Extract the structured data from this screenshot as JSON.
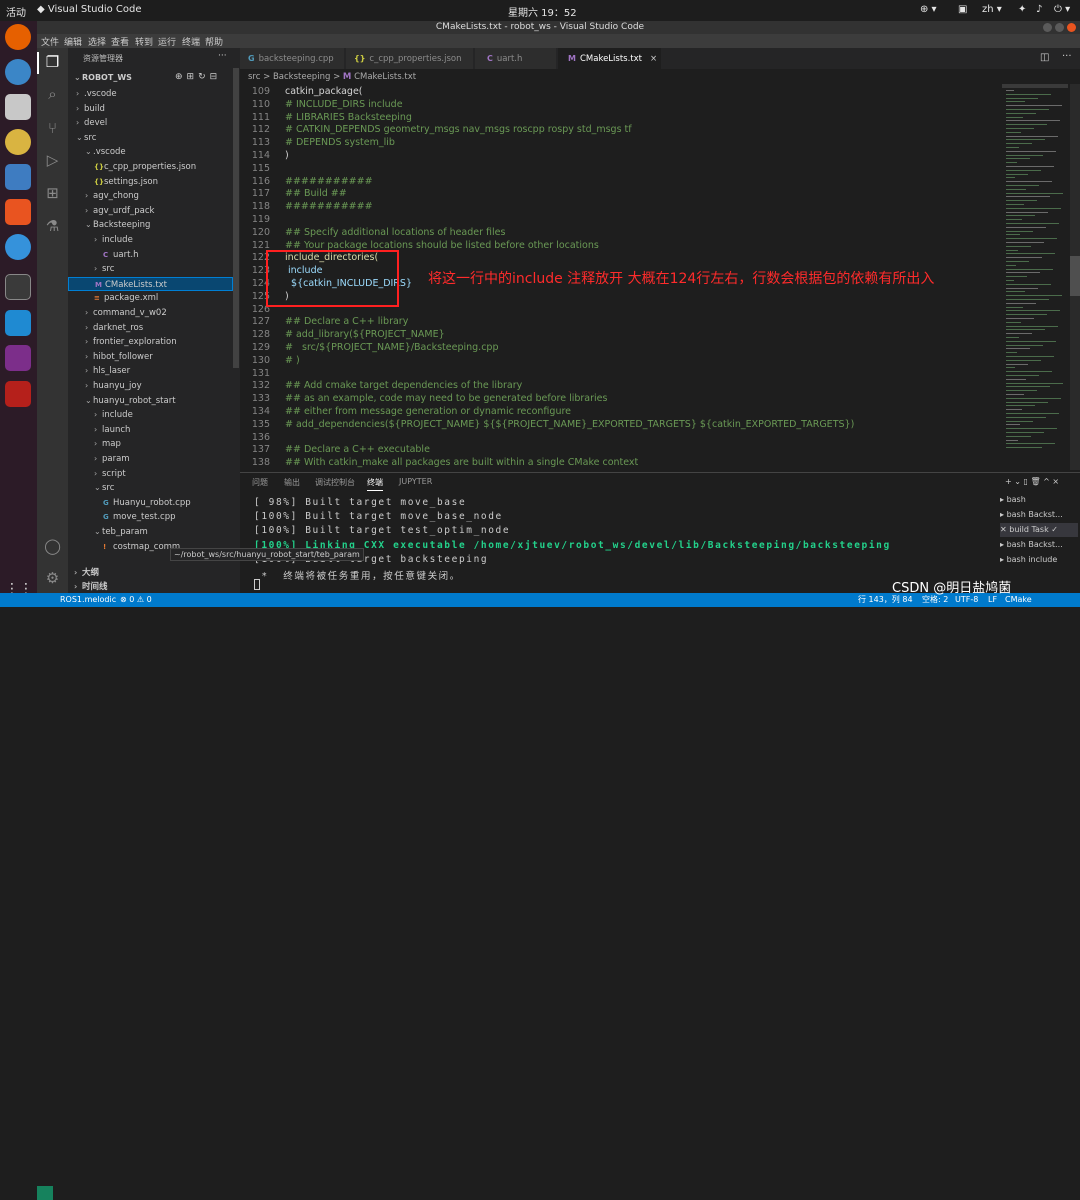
{
  "system_bar": {
    "activities": "活动",
    "app": "Visual Studio Code",
    "clock": "星期六 19：52",
    "lang": "zh"
  },
  "window": {
    "title": "CMakeLists.txt - robot_ws - Visual Studio Code"
  },
  "menu": [
    "文件",
    "编辑",
    "选择",
    "查看",
    "转到",
    "运行",
    "终端",
    "帮助"
  ],
  "sidebar": {
    "header": "资源管理器",
    "more": "···",
    "root": "ROBOT_WS",
    "tooltip": "~/robot_ws/src/huanyu_robot_start/teb_param",
    "outline": "大纲",
    "timeline": "时间线",
    "items": [
      {
        "label": ".vscode",
        "type": "folder",
        "open": false,
        "depth": 0
      },
      {
        "label": "build",
        "type": "folder",
        "open": false,
        "depth": 0
      },
      {
        "label": "devel",
        "type": "folder",
        "open": false,
        "depth": 0
      },
      {
        "label": "src",
        "type": "folder",
        "open": true,
        "depth": 0
      },
      {
        "label": ".vscode",
        "type": "folder",
        "open": true,
        "depth": 1
      },
      {
        "label": "c_cpp_properties.json",
        "type": "json",
        "icon": "{}",
        "depth": 2
      },
      {
        "label": "settings.json",
        "type": "json",
        "icon": "{}",
        "depth": 2
      },
      {
        "label": "agv_chong",
        "type": "folder",
        "open": false,
        "depth": 1
      },
      {
        "label": "agv_urdf_pack",
        "type": "folder",
        "open": false,
        "depth": 1
      },
      {
        "label": "Backsteeping",
        "type": "folder",
        "open": true,
        "depth": 1
      },
      {
        "label": "include",
        "type": "folder",
        "open": false,
        "depth": 2
      },
      {
        "label": "uart.h",
        "type": "c",
        "icon": "C",
        "depth": 3
      },
      {
        "label": "src",
        "type": "folder",
        "open": false,
        "depth": 2
      },
      {
        "label": "CMakeLists.txt",
        "type": "cmake",
        "icon": "M",
        "depth": 2,
        "selected": true
      },
      {
        "label": "package.xml",
        "type": "xml",
        "icon": "≡",
        "depth": 2
      },
      {
        "label": "command_v_w02",
        "type": "folder",
        "open": false,
        "depth": 1
      },
      {
        "label": "darknet_ros",
        "type": "folder",
        "open": false,
        "depth": 1
      },
      {
        "label": "frontier_exploration",
        "type": "folder",
        "open": false,
        "depth": 1
      },
      {
        "label": "hibot_follower",
        "type": "folder",
        "open": false,
        "depth": 1
      },
      {
        "label": "hls_laser",
        "type": "folder",
        "open": false,
        "depth": 1
      },
      {
        "label": "huanyu_joy",
        "type": "folder",
        "open": false,
        "depth": 1
      },
      {
        "label": "huanyu_robot_start",
        "type": "folder",
        "open": true,
        "depth": 1
      },
      {
        "label": "include",
        "type": "folder",
        "open": false,
        "depth": 2
      },
      {
        "label": "launch",
        "type": "folder",
        "open": false,
        "depth": 2
      },
      {
        "label": "map",
        "type": "folder",
        "open": false,
        "depth": 2
      },
      {
        "label": "param",
        "type": "folder",
        "open": false,
        "depth": 2
      },
      {
        "label": "script",
        "type": "folder",
        "open": false,
        "depth": 2
      },
      {
        "label": "src",
        "type": "folder",
        "open": true,
        "depth": 2
      },
      {
        "label": "Huanyu_robot.cpp",
        "type": "cpp",
        "icon": "G",
        "depth": 3
      },
      {
        "label": "move_test.cpp",
        "type": "cpp",
        "icon": "G",
        "depth": 3
      },
      {
        "label": "teb_param",
        "type": "folder",
        "open": true,
        "depth": 2
      },
      {
        "label": "costmap_comm",
        "type": "xml",
        "icon": "!",
        "depth": 3
      }
    ]
  },
  "tabs": [
    {
      "label": "backsteeping.cpp",
      "icon": "G",
      "color": "#519aba"
    },
    {
      "label": "c_cpp_properties.json",
      "icon": "{}",
      "color": "#cbcb41"
    },
    {
      "label": "uart.h",
      "icon": "C",
      "color": "#a074c4"
    },
    {
      "label": "CMakeLists.txt",
      "icon": "M",
      "color": "#a074c4",
      "active": true,
      "close": "×"
    }
  ],
  "breadcrumb": {
    "folder1": "src",
    "sep": ">",
    "folder2": "Backsteeping",
    "file": "CMakeLists.txt"
  },
  "code_lines": [
    {
      "n": "109",
      "t": "catkin_package(",
      "c": "def"
    },
    {
      "n": "110",
      "t": "# INCLUDE_DIRS include",
      "c": "com"
    },
    {
      "n": "111",
      "t": "# LIBRARIES Backsteeping",
      "c": "com"
    },
    {
      "n": "112",
      "t": "# CATKIN_DEPENDS geometry_msgs nav_msgs roscpp rospy std_msgs tf",
      "c": "com"
    },
    {
      "n": "113",
      "t": "# DEPENDS system_lib",
      "c": "com"
    },
    {
      "n": "114",
      "t": ")",
      "c": "def"
    },
    {
      "n": "115",
      "t": "",
      "c": "def"
    },
    {
      "n": "116",
      "t": "###########",
      "c": "com"
    },
    {
      "n": "117",
      "t": "## Build ##",
      "c": "com"
    },
    {
      "n": "118",
      "t": "###########",
      "c": "com"
    },
    {
      "n": "119",
      "t": "",
      "c": "def"
    },
    {
      "n": "120",
      "t": "## Specify additional locations of header files",
      "c": "com"
    },
    {
      "n": "121",
      "t": "## Your package locations should be listed before other locations",
      "c": "com"
    },
    {
      "n": "122",
      "t": "include_directories(",
      "c": "fn"
    },
    {
      "n": "123",
      "t": " include",
      "c": "var"
    },
    {
      "n": "124",
      "t": "  ${catkin_INCLUDE_DIRS}",
      "c": "var"
    },
    {
      "n": "125",
      "t": ")",
      "c": "def"
    },
    {
      "n": "126",
      "t": "",
      "c": "def"
    },
    {
      "n": "127",
      "t": "## Declare a C++ library",
      "c": "com"
    },
    {
      "n": "128",
      "t": "# add_library(${PROJECT_NAME}",
      "c": "com"
    },
    {
      "n": "129",
      "t": "#   src/${PROJECT_NAME}/Backsteeping.cpp",
      "c": "com"
    },
    {
      "n": "130",
      "t": "# )",
      "c": "com"
    },
    {
      "n": "131",
      "t": "",
      "c": "def"
    },
    {
      "n": "132",
      "t": "## Add cmake target dependencies of the library",
      "c": "com"
    },
    {
      "n": "133",
      "t": "## as an example, code may need to be generated before libraries",
      "c": "com"
    },
    {
      "n": "134",
      "t": "## either from message generation or dynamic reconfigure",
      "c": "com"
    },
    {
      "n": "135",
      "t": "# add_dependencies(${PROJECT_NAME} ${${PROJECT_NAME}_EXPORTED_TARGETS} ${catkin_EXPORTED_TARGETS})",
      "c": "com"
    },
    {
      "n": "136",
      "t": "",
      "c": "def"
    },
    {
      "n": "137",
      "t": "## Declare a C++ executable",
      "c": "com"
    },
    {
      "n": "138",
      "t": "## With catkin_make all packages are built within a single CMake context",
      "c": "com"
    }
  ],
  "annotation": "将这一行中的include 注释放开   大概在124行左右，行数会根据包的依赖有所出入",
  "panel": {
    "tabs": [
      "问题",
      "输出",
      "调试控制台",
      "终端",
      "JUPYTER"
    ],
    "active_tab": "终端",
    "actions": "+ ⌄ ▯ 🗑 ^ ×",
    "lines": [
      {
        "t": "[ 98%] Built target move_base",
        "green": false
      },
      {
        "t": "[100%] Built target move_base_node",
        "green": false
      },
      {
        "t": "[100%] Built target test_optim_node",
        "green": false
      },
      {
        "t": "[100%] Linking CXX executable /home/xjtuev/robot_ws/devel/lib/Backsteeping/backsteeping",
        "green": true
      },
      {
        "t": "[100%] Built target backsteeping",
        "green": false
      },
      {
        "t": " *  终端将被任务重用，按任意键关闭。",
        "green": false
      }
    ],
    "terminals": [
      {
        "label": "bash",
        "selected": false
      },
      {
        "label": "bash  Backst...",
        "selected": false
      },
      {
        "label": "build  Task  ✓",
        "selected": true
      },
      {
        "label": "bash  Backst...",
        "selected": false
      },
      {
        "label": "bash  include",
        "selected": false
      }
    ]
  },
  "status": {
    "branch": "ROS1.melodic",
    "problems": "⊗ 0 ⚠ 0",
    "position": "行 143，列 84",
    "spaces": "空格: 2",
    "encoding": "UTF-8",
    "eol": "LF",
    "lang": "CMake"
  },
  "watermark": "CSDN @明日盐鸠菌"
}
